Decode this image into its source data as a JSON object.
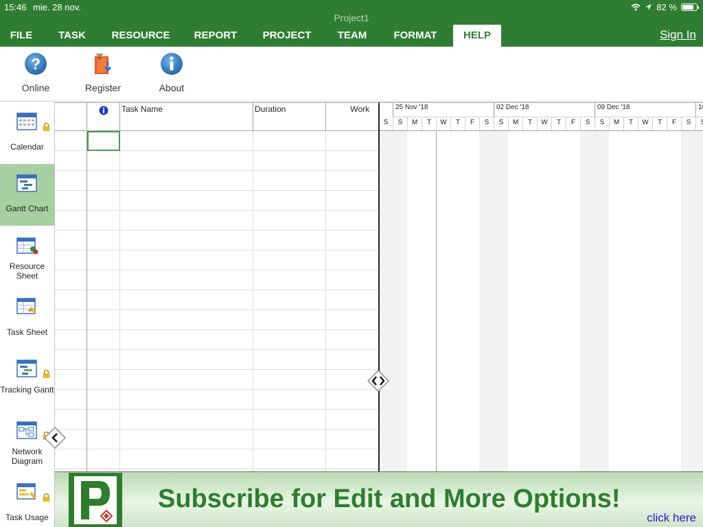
{
  "status_bar": {
    "time": "15:46",
    "date": "mie. 28 nov.",
    "battery": "82 %",
    "battery_level": 0.82
  },
  "app_title": "Project1",
  "tabs": [
    {
      "label": "FILE"
    },
    {
      "label": "TASK"
    },
    {
      "label": "RESOURCE"
    },
    {
      "label": "REPORT"
    },
    {
      "label": "PROJECT"
    },
    {
      "label": "TEAM"
    },
    {
      "label": "FORMAT"
    },
    {
      "label": "HELP",
      "active": true
    }
  ],
  "sign_in": "Sign In",
  "ribbon": {
    "buttons": [
      {
        "label": "Online",
        "icon": "question-icon"
      },
      {
        "label": "Register",
        "icon": "register-icon"
      },
      {
        "label": "About",
        "icon": "info-icon"
      }
    ]
  },
  "sidebar": {
    "items": [
      {
        "label": "Calendar",
        "icon": "calendar-view-icon",
        "locked": true
      },
      {
        "label": "Gantt Chart",
        "icon": "gantt-view-icon",
        "active": true
      },
      {
        "label": "Resource Sheet",
        "icon": "resource-sheet-icon"
      },
      {
        "label": "Task Sheet",
        "icon": "task-sheet-icon"
      },
      {
        "label": "Tracking Gantt",
        "icon": "tracking-gantt-icon",
        "locked": true
      },
      {
        "label": "Network Diagram",
        "icon": "network-diagram-icon",
        "locked": true
      },
      {
        "label": "Task Usage",
        "icon": "task-usage-icon",
        "locked": true
      }
    ]
  },
  "grid": {
    "columns": [
      {
        "label": ""
      },
      {
        "label": "",
        "icon": "info-icon"
      },
      {
        "label": "Task Name"
      },
      {
        "label": "Duration"
      },
      {
        "label": "Work"
      }
    ],
    "rows": [
      [],
      [],
      [],
      [],
      [],
      [],
      [],
      [],
      [],
      [],
      [],
      [],
      [],
      [],
      [],
      [],
      [],
      []
    ]
  },
  "gantt": {
    "weeks": [
      "25 Nov '18",
      "02 Dec '18",
      "09 Dec '18",
      "16"
    ],
    "days": [
      "S",
      "S",
      "M",
      "T",
      "W",
      "T",
      "F",
      "S",
      "S",
      "M",
      "T",
      "W",
      "T",
      "F",
      "S",
      "S",
      "M",
      "T",
      "W",
      "T",
      "F",
      "S",
      "S"
    ]
  },
  "banner": {
    "text": "Subscribe for Edit and More Options!",
    "link": "click here"
  },
  "colors": {
    "brand_green": "#2f7d32",
    "active_sidebar": "#a8cfa2"
  }
}
